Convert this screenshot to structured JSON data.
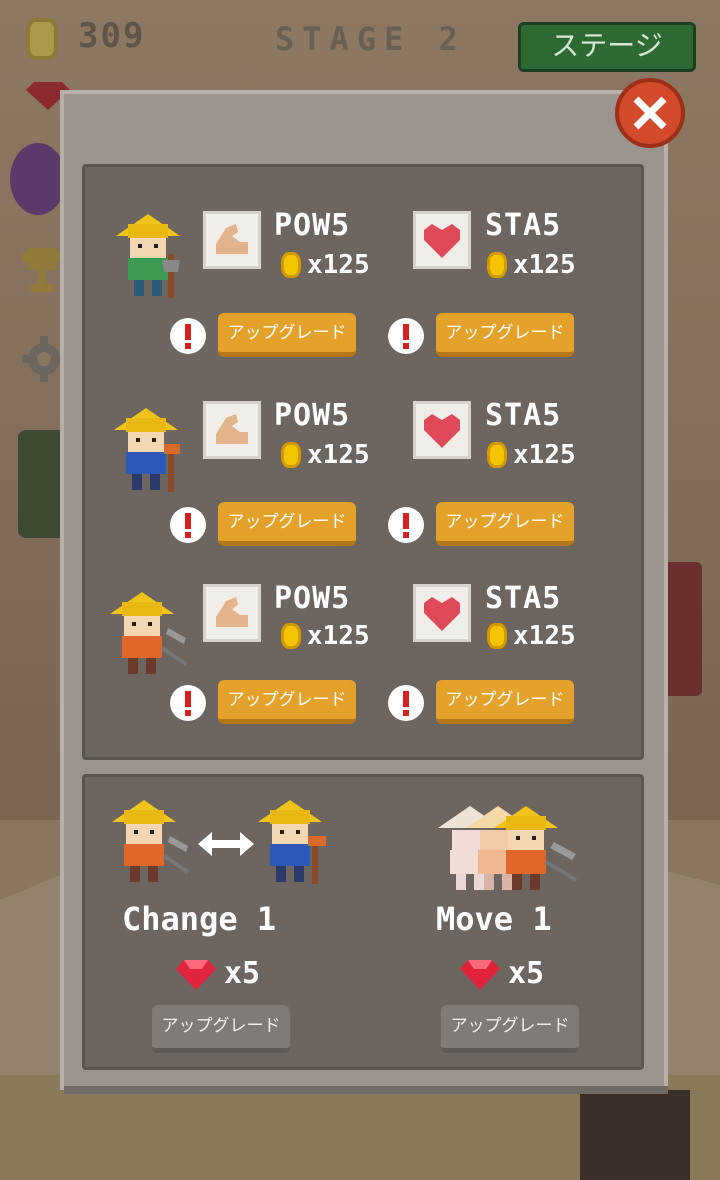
{
  "top_bar": {
    "coins": "309",
    "stage": "STAGE 2",
    "stage_button": "ステージ"
  },
  "upgrades": [
    {
      "miner_color": "green",
      "pow": {
        "label": "POW5",
        "cost": "x125"
      },
      "sta": {
        "label": "STA5",
        "cost": "x125"
      },
      "pow_button": "アップグレード",
      "sta_button": "アップグレード"
    },
    {
      "miner_color": "blue",
      "pow": {
        "label": "POW5",
        "cost": "x125"
      },
      "sta": {
        "label": "STA5",
        "cost": "x125"
      },
      "pow_button": "アップグレード",
      "sta_button": "アップグレード"
    },
    {
      "miner_color": "orange",
      "pow": {
        "label": "POW5",
        "cost": "x125"
      },
      "sta": {
        "label": "STA5",
        "cost": "x125"
      },
      "pow_button": "アップグレード",
      "sta_button": "アップグレード"
    }
  ],
  "skills": {
    "change": {
      "label": "Change 1",
      "cost": "x5",
      "button": "アップグレード"
    },
    "move": {
      "label": "Move 1",
      "cost": "x5",
      "button": "アップグレード"
    }
  },
  "colors": {
    "upgrade_button": "#e5a22a",
    "close_button": "#d24a2a",
    "stage_button": "#2f6a35",
    "coin": "#f5c400",
    "gem": "#e0243c"
  },
  "icons": [
    "coin-icon",
    "gem-icon",
    "muscle-icon",
    "heart-icon",
    "alert-icon",
    "close-icon",
    "swap-arrow-icon",
    "trophy-icon",
    "gear-icon"
  ]
}
